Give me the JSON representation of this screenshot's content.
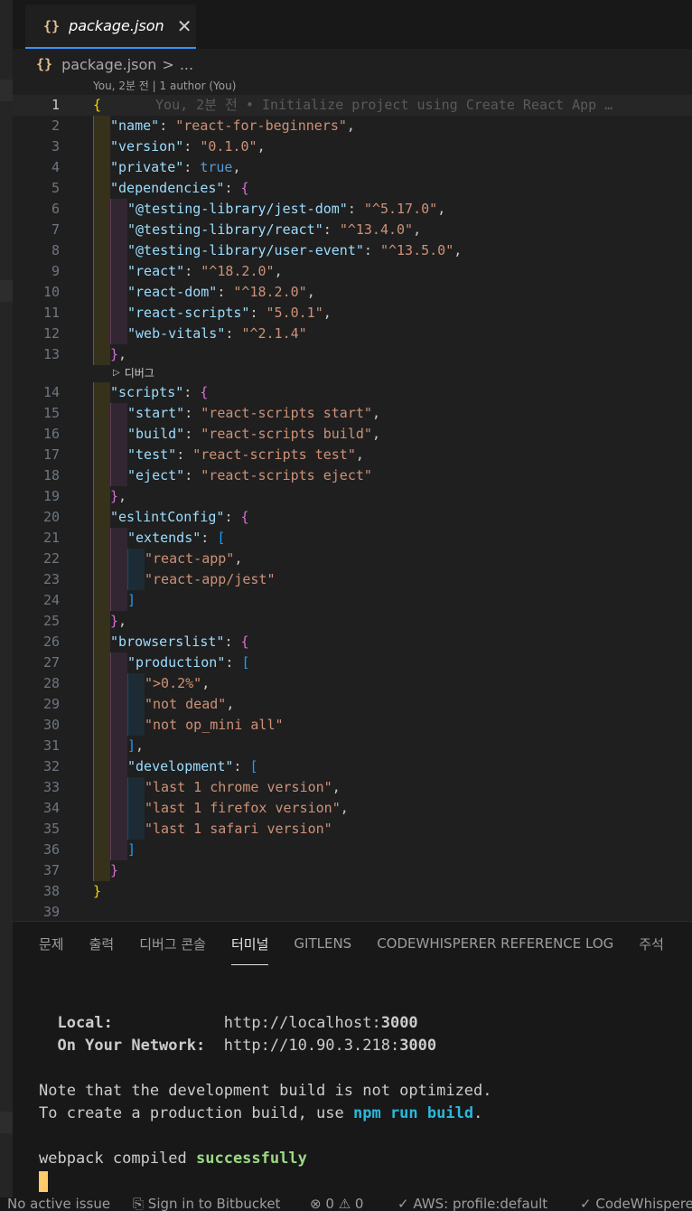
{
  "tab": {
    "icon": "json-braces-icon",
    "braces": "{}",
    "name": "package.json",
    "close": "✕"
  },
  "breadcrumb": {
    "braces": "{}",
    "file": "package.json",
    "sep": ">",
    "more": "..."
  },
  "codelens": "You, 2분 전 | 1 author (You)",
  "blame": "You, 2분 전 • Initialize project using Create React App …",
  "debug_lens": "디버그",
  "panel": {
    "tabs": [
      "문제",
      "출력",
      "디버그 콘솔",
      "터미널",
      "GITLENS",
      "CODEWHISPERER REFERENCE LOG",
      "주석"
    ],
    "active_tab": "터미널"
  },
  "terminal": {
    "local_label": "  Local:",
    "local_url_prefix": "http://localhost:",
    "local_port": "3000",
    "network_label": "  On Your Network:",
    "network_url_prefix": "http://10.90.3.218:",
    "network_port": "3000",
    "note1": "Note that the development build is not optimized.",
    "note2_prefix": "To create a production build, use ",
    "note2_cmd": "npm run build",
    "note2_suffix": ".",
    "compiled_prefix": "webpack compiled ",
    "compiled_status": "successfully"
  },
  "statusbar": {
    "no_issue": "No active issue",
    "bitbucket": "Sign in to Bitbucket",
    "errors": "0",
    "warnings": "0",
    "aws": "AWS: profile:default",
    "codewhisperer": "CodeWhisperer"
  },
  "colors": {
    "key": "#9cdcfe",
    "string": "#ce9178",
    "bool": "#569cd6",
    "accent": "#3794ff"
  },
  "code_lines": [
    {
      "n": "1",
      "indent": 0,
      "tokens": [
        [
          "br1",
          "{"
        ]
      ]
    },
    {
      "n": "2",
      "indent": 1,
      "tokens": [
        [
          "k",
          "\"name\""
        ],
        [
          "p",
          ": "
        ],
        [
          "s",
          "\"react-for-beginners\""
        ],
        [
          "p",
          ","
        ]
      ]
    },
    {
      "n": "3",
      "indent": 1,
      "tokens": [
        [
          "k",
          "\"version\""
        ],
        [
          "p",
          ": "
        ],
        [
          "s",
          "\"0.1.0\""
        ],
        [
          "p",
          ","
        ]
      ]
    },
    {
      "n": "4",
      "indent": 1,
      "tokens": [
        [
          "k",
          "\"private\""
        ],
        [
          "p",
          ": "
        ],
        [
          "b",
          "true"
        ],
        [
          "p",
          ","
        ]
      ]
    },
    {
      "n": "5",
      "indent": 1,
      "tokens": [
        [
          "k",
          "\"dependencies\""
        ],
        [
          "p",
          ": "
        ],
        [
          "br2",
          "{"
        ]
      ]
    },
    {
      "n": "6",
      "indent": 2,
      "tokens": [
        [
          "k",
          "\"@testing-library/jest-dom\""
        ],
        [
          "p",
          ": "
        ],
        [
          "s",
          "\"^5.17.0\""
        ],
        [
          "p",
          ","
        ]
      ]
    },
    {
      "n": "7",
      "indent": 2,
      "tokens": [
        [
          "k",
          "\"@testing-library/react\""
        ],
        [
          "p",
          ": "
        ],
        [
          "s",
          "\"^13.4.0\""
        ],
        [
          "p",
          ","
        ]
      ]
    },
    {
      "n": "8",
      "indent": 2,
      "tokens": [
        [
          "k",
          "\"@testing-library/user-event\""
        ],
        [
          "p",
          ": "
        ],
        [
          "s",
          "\"^13.5.0\""
        ],
        [
          "p",
          ","
        ]
      ]
    },
    {
      "n": "9",
      "indent": 2,
      "tokens": [
        [
          "k",
          "\"react\""
        ],
        [
          "p",
          ": "
        ],
        [
          "s",
          "\"^18.2.0\""
        ],
        [
          "p",
          ","
        ]
      ]
    },
    {
      "n": "10",
      "indent": 2,
      "tokens": [
        [
          "k",
          "\"react-dom\""
        ],
        [
          "p",
          ": "
        ],
        [
          "s",
          "\"^18.2.0\""
        ],
        [
          "p",
          ","
        ]
      ]
    },
    {
      "n": "11",
      "indent": 2,
      "tokens": [
        [
          "k",
          "\"react-scripts\""
        ],
        [
          "p",
          ": "
        ],
        [
          "s",
          "\"5.0.1\""
        ],
        [
          "p",
          ","
        ]
      ]
    },
    {
      "n": "12",
      "indent": 2,
      "tokens": [
        [
          "k",
          "\"web-vitals\""
        ],
        [
          "p",
          ": "
        ],
        [
          "s",
          "\"^2.1.4\""
        ]
      ]
    },
    {
      "n": "13",
      "indent": 1,
      "tokens": [
        [
          "br2",
          "}"
        ],
        [
          "p",
          ","
        ]
      ]
    },
    {
      "n": "14",
      "indent": 1,
      "tokens": [
        [
          "k",
          "\"scripts\""
        ],
        [
          "p",
          ": "
        ],
        [
          "br2",
          "{"
        ]
      ]
    },
    {
      "n": "15",
      "indent": 2,
      "tokens": [
        [
          "k",
          "\"start\""
        ],
        [
          "p",
          ": "
        ],
        [
          "s",
          "\"react-scripts start\""
        ],
        [
          "p",
          ","
        ]
      ]
    },
    {
      "n": "16",
      "indent": 2,
      "tokens": [
        [
          "k",
          "\"build\""
        ],
        [
          "p",
          ": "
        ],
        [
          "s",
          "\"react-scripts build\""
        ],
        [
          "p",
          ","
        ]
      ]
    },
    {
      "n": "17",
      "indent": 2,
      "tokens": [
        [
          "k",
          "\"test\""
        ],
        [
          "p",
          ": "
        ],
        [
          "s",
          "\"react-scripts test\""
        ],
        [
          "p",
          ","
        ]
      ]
    },
    {
      "n": "18",
      "indent": 2,
      "tokens": [
        [
          "k",
          "\"eject\""
        ],
        [
          "p",
          ": "
        ],
        [
          "s",
          "\"react-scripts eject\""
        ]
      ]
    },
    {
      "n": "19",
      "indent": 1,
      "tokens": [
        [
          "br2",
          "}"
        ],
        [
          "p",
          ","
        ]
      ]
    },
    {
      "n": "20",
      "indent": 1,
      "tokens": [
        [
          "k",
          "\"eslintConfig\""
        ],
        [
          "p",
          ": "
        ],
        [
          "br2",
          "{"
        ]
      ]
    },
    {
      "n": "21",
      "indent": 2,
      "tokens": [
        [
          "k",
          "\"extends\""
        ],
        [
          "p",
          ": "
        ],
        [
          "br3",
          "["
        ]
      ]
    },
    {
      "n": "22",
      "indent": 3,
      "tokens": [
        [
          "s",
          "\"react-app\""
        ],
        [
          "p",
          ","
        ]
      ]
    },
    {
      "n": "23",
      "indent": 3,
      "tokens": [
        [
          "s",
          "\"react-app/jest\""
        ]
      ]
    },
    {
      "n": "24",
      "indent": 2,
      "tokens": [
        [
          "br3",
          "]"
        ]
      ]
    },
    {
      "n": "25",
      "indent": 1,
      "tokens": [
        [
          "br2",
          "}"
        ],
        [
          "p",
          ","
        ]
      ]
    },
    {
      "n": "26",
      "indent": 1,
      "tokens": [
        [
          "k",
          "\"browserslist\""
        ],
        [
          "p",
          ": "
        ],
        [
          "br2",
          "{"
        ]
      ]
    },
    {
      "n": "27",
      "indent": 2,
      "tokens": [
        [
          "k",
          "\"production\""
        ],
        [
          "p",
          ": "
        ],
        [
          "br3",
          "["
        ]
      ]
    },
    {
      "n": "28",
      "indent": 3,
      "tokens": [
        [
          "s",
          "\">0.2%\""
        ],
        [
          "p",
          ","
        ]
      ]
    },
    {
      "n": "29",
      "indent": 3,
      "tokens": [
        [
          "s",
          "\"not dead\""
        ],
        [
          "p",
          ","
        ]
      ]
    },
    {
      "n": "30",
      "indent": 3,
      "tokens": [
        [
          "s",
          "\"not op_mini all\""
        ]
      ]
    },
    {
      "n": "31",
      "indent": 2,
      "tokens": [
        [
          "br3",
          "]"
        ],
        [
          "p",
          ","
        ]
      ]
    },
    {
      "n": "32",
      "indent": 2,
      "tokens": [
        [
          "k",
          "\"development\""
        ],
        [
          "p",
          ": "
        ],
        [
          "br3",
          "["
        ]
      ]
    },
    {
      "n": "33",
      "indent": 3,
      "tokens": [
        [
          "s",
          "\"last 1 chrome version\""
        ],
        [
          "p",
          ","
        ]
      ]
    },
    {
      "n": "34",
      "indent": 3,
      "tokens": [
        [
          "s",
          "\"last 1 firefox version\""
        ],
        [
          "p",
          ","
        ]
      ]
    },
    {
      "n": "35",
      "indent": 3,
      "tokens": [
        [
          "s",
          "\"last 1 safari version\""
        ]
      ]
    },
    {
      "n": "36",
      "indent": 2,
      "tokens": [
        [
          "br3",
          "]"
        ]
      ]
    },
    {
      "n": "37",
      "indent": 1,
      "tokens": [
        [
          "br2",
          "}"
        ]
      ]
    },
    {
      "n": "38",
      "indent": 0,
      "tokens": [
        [
          "br1",
          "}"
        ]
      ]
    },
    {
      "n": "39",
      "indent": 0,
      "tokens": []
    }
  ]
}
